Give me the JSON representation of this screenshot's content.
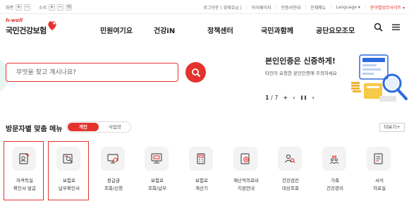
{
  "utility": {
    "home": "화면",
    "sound": "소리",
    "plus": "+",
    "minus": "−",
    "reset": "⟲",
    "links": [
      "로그아웃 ( 강태호님 )",
      "마이페이지",
      "인증서안내",
      "전체메뉴",
      "Language ▾"
    ],
    "site_select": "분야별업무사이트 ▾"
  },
  "header": {
    "logo_tagline": "h-well",
    "logo_name": "국민건강보험",
    "nav": [
      "민원여기요",
      "건강iN",
      "정책센터",
      "국민과함께",
      "공단요모조모"
    ]
  },
  "search": {
    "placeholder": "무엇을 찾고 계시나요?"
  },
  "banner": {
    "title": "본인인증은 신중하게!",
    "subtitle": "타인이 요청한 본인인증에 주의하세요",
    "page": "1",
    "total": "7",
    "plus": "+",
    "prev": "‹",
    "pause": "❚❚",
    "next": "›"
  },
  "menu_section": {
    "title": "방문자별 맞춤 메뉴",
    "tab_personal": "개인",
    "tab_business": "사업장",
    "more": "더보기+"
  },
  "menu_items": [
    {
      "line1": "자격득실",
      "line2": "확인서 발급"
    },
    {
      "line1": "보험료",
      "line2": "납부확인서"
    },
    {
      "line1": "환급금",
      "line2": "조회/신청"
    },
    {
      "line1": "보험료",
      "line2": "조회/납부"
    },
    {
      "line1": "보험료",
      "line2": "계산기"
    },
    {
      "line1": "재난적의료비",
      "line2": "지원안내"
    },
    {
      "line1": "건강검진",
      "line2": "대상조회"
    },
    {
      "line1": "가족",
      "line2": "건강관리"
    },
    {
      "line1": "서식",
      "line2": "자료실"
    }
  ],
  "colors": {
    "accent": "#e4322c",
    "icon_bg": "#f3f3f3"
  }
}
